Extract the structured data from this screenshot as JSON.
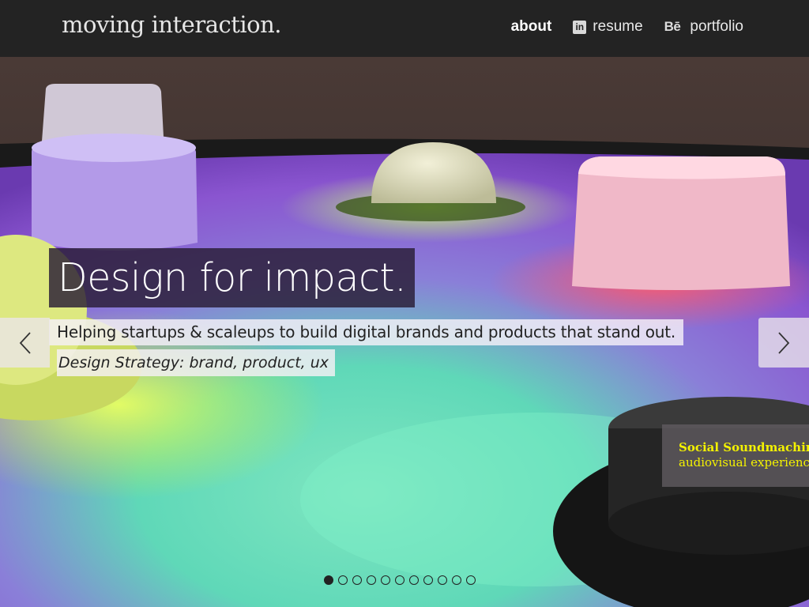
{
  "header": {
    "logo": "moving interaction.",
    "nav": [
      {
        "label": "about",
        "icon": "",
        "active": true
      },
      {
        "label": "resume",
        "icon": "linkedin-icon"
      },
      {
        "label": "portfolio",
        "icon": "behance-icon"
      }
    ],
    "linkedin_glyph": "in",
    "behance_glyph": "Bē"
  },
  "hero": {
    "headline": "Design for impact.",
    "subline": "Helping startups & scaleups to build digital brands and products that stand out.",
    "tagline": "Design Strategy: brand, product, ux",
    "caption_title": "Social Soundmachine",
    "caption_sub": "audiovisual experience",
    "slides_total": 11,
    "active_slide": 1
  },
  "colors": {
    "header_bg": "#232323",
    "caption_text": "#f4f200"
  }
}
